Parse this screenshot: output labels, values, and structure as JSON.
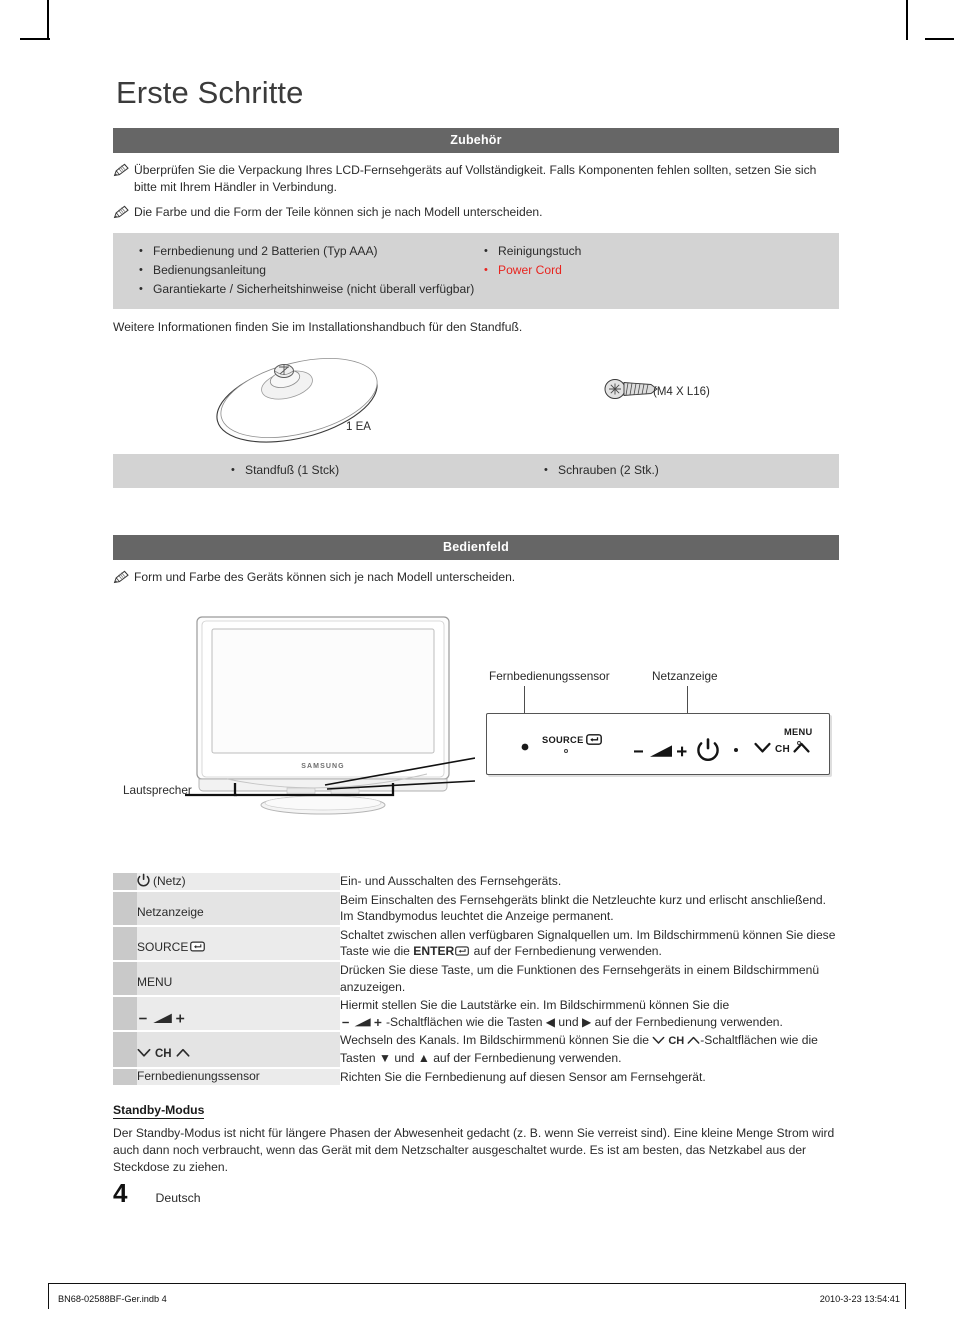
{
  "document": {
    "title": "Erste Schritte",
    "page_number": "4",
    "language": "Deutsch",
    "print_file": "BN68-02588BF-Ger.indb   4",
    "print_timestamp": "2010-3-23   13:54:41"
  },
  "accessories_section": {
    "heading": "Zubehör",
    "notes": [
      "Überprüfen Sie die Verpackung Ihres LCD-Fernsehgeräts auf Vollständigkeit. Falls Komponenten fehlen sollten, setzen Sie sich bitte mit Ihrem Händler in Verbindung.",
      "Die Farbe und die Form der Teile können sich je nach Modell unterscheiden."
    ],
    "items_left": [
      "Fernbedienung und 2 Batterien (Typ AAA)",
      "Bedienungsanleitung",
      "Garantiekarte / Sicherheitshinweise (nicht überall verfügbar)"
    ],
    "items_right": [
      "Reinigungstuch",
      "Power Cord"
    ],
    "highlight_color": "#e8241f",
    "footnote": "Weitere Informationen finden Sie im Installationshandbuch für den Standfuß.",
    "illustration": {
      "stand_quantity": "1 EA",
      "screw_spec": "(M4 X L16)"
    },
    "parts_left": "Standfuß (1 Stck)",
    "parts_right": "Schrauben (2 Stk.)"
  },
  "control_panel_section": {
    "heading": "Bedienfeld",
    "note": "Form und Farbe des Geräts können sich je nach Modell unterscheiden.",
    "callouts": {
      "sensor": "Fernbedienungssensor",
      "power_indicator": "Netzanzeige",
      "speaker": "Lautsprecher"
    },
    "tv_brand": "SAMSUNG",
    "panel_labels": {
      "source": "SOURCE",
      "volume_minus": "–",
      "volume_plus": "+",
      "channel": "CH",
      "menu": "MENU"
    }
  },
  "function_table": {
    "rows": [
      {
        "key": "(Netz)",
        "key_icon": "power-icon",
        "desc": "Ein- und Ausschalten des Fernsehgeräts."
      },
      {
        "key": "Netzanzeige",
        "key_icon": "",
        "desc": "Beim Einschalten des Fernsehgeräts blinkt die Netzleuchte kurz und erlischt anschließend. Im Standbymodus leuchtet die Anzeige permanent."
      },
      {
        "key": "SOURCE",
        "key_icon": "enter-icon",
        "desc_part1": "Schaltet zwischen allen verfügbaren Signalquellen um. Im Bildschirmmenü können Sie diese Taste wie die ",
        "desc_bold": "ENTER",
        "desc_part2": " auf der Fernbedienung verwenden."
      },
      {
        "key": "MENU",
        "key_icon": "",
        "desc": "Drücken Sie diese Taste, um die Funktionen des Fernsehgeräts in einem Bildschirmmenü anzuzeigen."
      },
      {
        "key": "– ◢ +",
        "key_icon": "volume-icon",
        "desc_part1": "Hiermit stellen Sie die Lautstärke ein. Im Bildschirmmenü können Sie die ",
        "desc_part2": "-Schaltflächen wie die Tasten ◀ und ▶ auf der Fernbedienung verwenden."
      },
      {
        "key": "CH",
        "key_icon": "channel-icon",
        "desc_part1": "Wechseln des Kanals. Im Bildschirmmenü können Sie die ",
        "desc_part2": "-Schaltflächen wie die Tasten ▼ und ▲ auf der Fernbedienung verwenden."
      },
      {
        "key": "Fernbedienungssensor",
        "key_icon": "",
        "desc": "Richten Sie die Fernbedienung auf diesen Sensor am Fernsehgerät."
      }
    ]
  },
  "standby_section": {
    "heading": "Standby-Modus",
    "body": "Der Standby-Modus ist nicht für längere Phasen der Abwesenheit gedacht (z. B. wenn Sie verreist sind). Eine kleine Menge Strom wird auch dann noch verbraucht, wenn das Gerät mit dem Netzschalter ausgeschaltet wurde. Es ist am besten, das Netzkabel aus der Steckdose zu ziehen."
  },
  "colors": {
    "section_bar": "#666666",
    "accessory_box": "#d3d3d3",
    "table_key": "#ebebeb",
    "table_strip": "#c9c9c9"
  }
}
